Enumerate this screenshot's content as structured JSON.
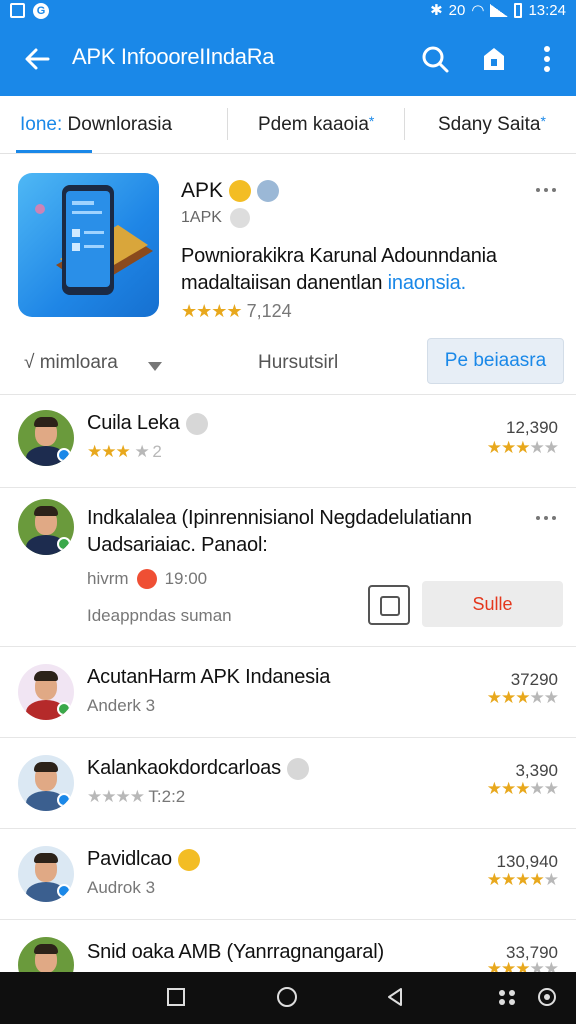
{
  "status_bar": {
    "time": "13:24",
    "mid": "20"
  },
  "app_bar": {
    "title": "APK InfoooreIIndaRa"
  },
  "tabs": [
    {
      "prefix": "Ione:",
      "label": "Downlorasia",
      "star": ""
    },
    {
      "prefix": "",
      "label": "Pdem kaaoia",
      "star": "*"
    },
    {
      "prefix": "",
      "label": "Sdany Saita",
      "star": "*"
    }
  ],
  "featured": {
    "name": "APK",
    "developer": "1APK",
    "desc_line1": "Powniorakikra Karunal Adounndania",
    "desc_line2_a": "madaltaiisan danentlan",
    "desc_line2_b": "inaonsia.",
    "stars": "★★★★",
    "rating_count": "7,124",
    "sort_label": "√ mimloara",
    "filter_label": "Hursutsirl",
    "primary_button": "Pe beiaasra"
  },
  "rows": [
    {
      "name": "Cuila Leka",
      "sub_stars": "★★★",
      "sub_text": "★ 2",
      "count": "12,390",
      "stars": "★★★",
      "stars_grey": "★★"
    },
    {
      "name": "Indkalalea (Ipinrennisianol Negdadelulatiann",
      "name2": "Uadsariaiac. Panaol:",
      "meta": "hivrm",
      "time": "19:00",
      "footer": "Ideappndas suman",
      "button": "Sulle"
    },
    {
      "name": "AcutanHarm APK Indanesia",
      "sub_text": "Anderk 3",
      "count": "37290",
      "stars": "★★★",
      "stars_grey": "★★"
    },
    {
      "name": "Kalankaokdordcarloas",
      "sub_stars": "★★★★",
      "sub_text": "T:2:2",
      "count": "3,390",
      "stars": "★★★",
      "stars_grey": "★★"
    },
    {
      "name": "Pavidlcao",
      "sub_text": "Audrok 3",
      "count": "130,940",
      "stars": "★★★★",
      "stars_grey": "★"
    },
    {
      "name": "Snid oaka AMB (Yanrragnangaral)",
      "count": "33,790",
      "stars": "★★★",
      "stars_grey": "★★"
    }
  ],
  "colors": {
    "accent": "#1a88e8",
    "star": "#e8a81d",
    "danger": "#e4371d"
  }
}
